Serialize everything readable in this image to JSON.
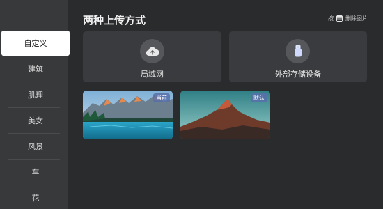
{
  "sidebar": {
    "items": [
      {
        "label": "自定义",
        "active": true
      },
      {
        "label": "建筑"
      },
      {
        "label": "肌理"
      },
      {
        "label": "美女"
      },
      {
        "label": "风景"
      },
      {
        "label": "车"
      },
      {
        "label": "花"
      }
    ]
  },
  "header": {
    "title": "两种上传方式",
    "hint_prefix": "按",
    "hint_icon": "menu-icon",
    "hint_action": "删除图片"
  },
  "upload_options": [
    {
      "label": "局域网",
      "icon": "cloud-upload-icon"
    },
    {
      "label": "外部存储设备",
      "icon": "usb-drive-icon"
    }
  ],
  "images": [
    {
      "badge": "当前",
      "scene": "mountain lake"
    },
    {
      "badge": "默认",
      "scene": "mountain peaks"
    }
  ],
  "colors": {
    "background": "#2a2b2d",
    "sidebar": "#38393b",
    "card": "#3a3b3e",
    "active_item": "#ffffff",
    "badge": "#586eaa"
  }
}
